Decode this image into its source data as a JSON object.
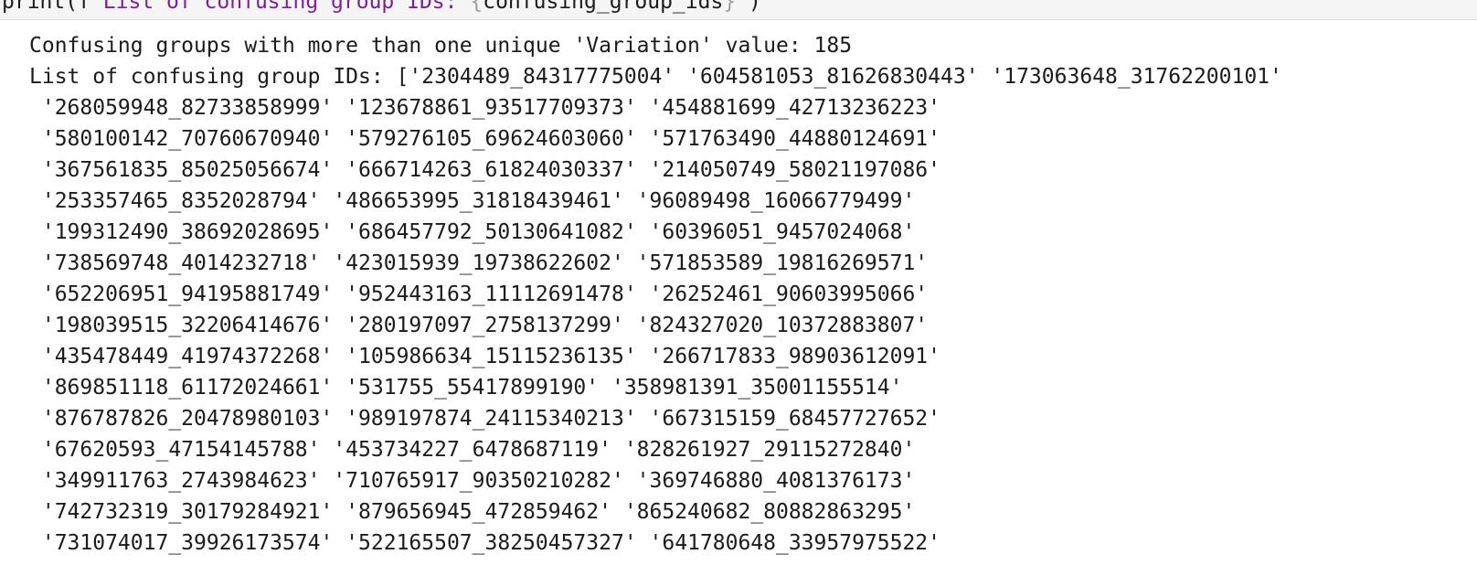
{
  "code_cell": {
    "prefix": "print(f'",
    "string_text": "List of confusing group IDs: ",
    "brace_open": "{",
    "variable": "confusing_group_ids",
    "brace_close": "}",
    "suffix": "')"
  },
  "output": {
    "summary_line": "Confusing groups with more than one unique 'Variation' value: 185",
    "list_lines": [
      "List of confusing group IDs: ['2304489_84317775004' '604581053_81626830443' '173063648_31762200101'",
      " '268059948_82733858999' '123678861_93517709373' '454881699_42713236223'",
      " '580100142_70760670940' '579276105_69624603060' '571763490_44880124691'",
      " '367561835_85025056674' '666714263_61824030337' '214050749_58021197086'",
      " '253357465_8352028794' '486653995_31818439461' '96089498_16066779499'",
      " '199312490_38692028695' '686457792_50130641082' '60396051_9457024068'",
      " '738569748_4014232718' '423015939_19738622602' '571853589_19816269571'",
      " '652206951_94195881749' '952443163_11112691478' '26252461_90603995066'",
      " '198039515_32206414676' '280197097_2758137299' '824327020_10372883807'",
      " '435478449_41974372268' '105986634_15115236135' '266717833_98903612091'",
      " '869851118_61172024661' '531755_55417899190' '358981391_35001155514'",
      " '876787826_20478980103' '989197874_24115340213' '667315159_68457727652'",
      " '67620593_47154145788' '453734227_6478687119' '828261927_29115272840'",
      " '349911763_2743984623' '710765917_90350210282' '369746880_4081376173'",
      " '742732319_30179284921' '879656945_472859462' '865240682_80882863295'",
      " '731074017_39926173574' '522165507_38250457327' '641780648_33957975522'"
    ]
  }
}
